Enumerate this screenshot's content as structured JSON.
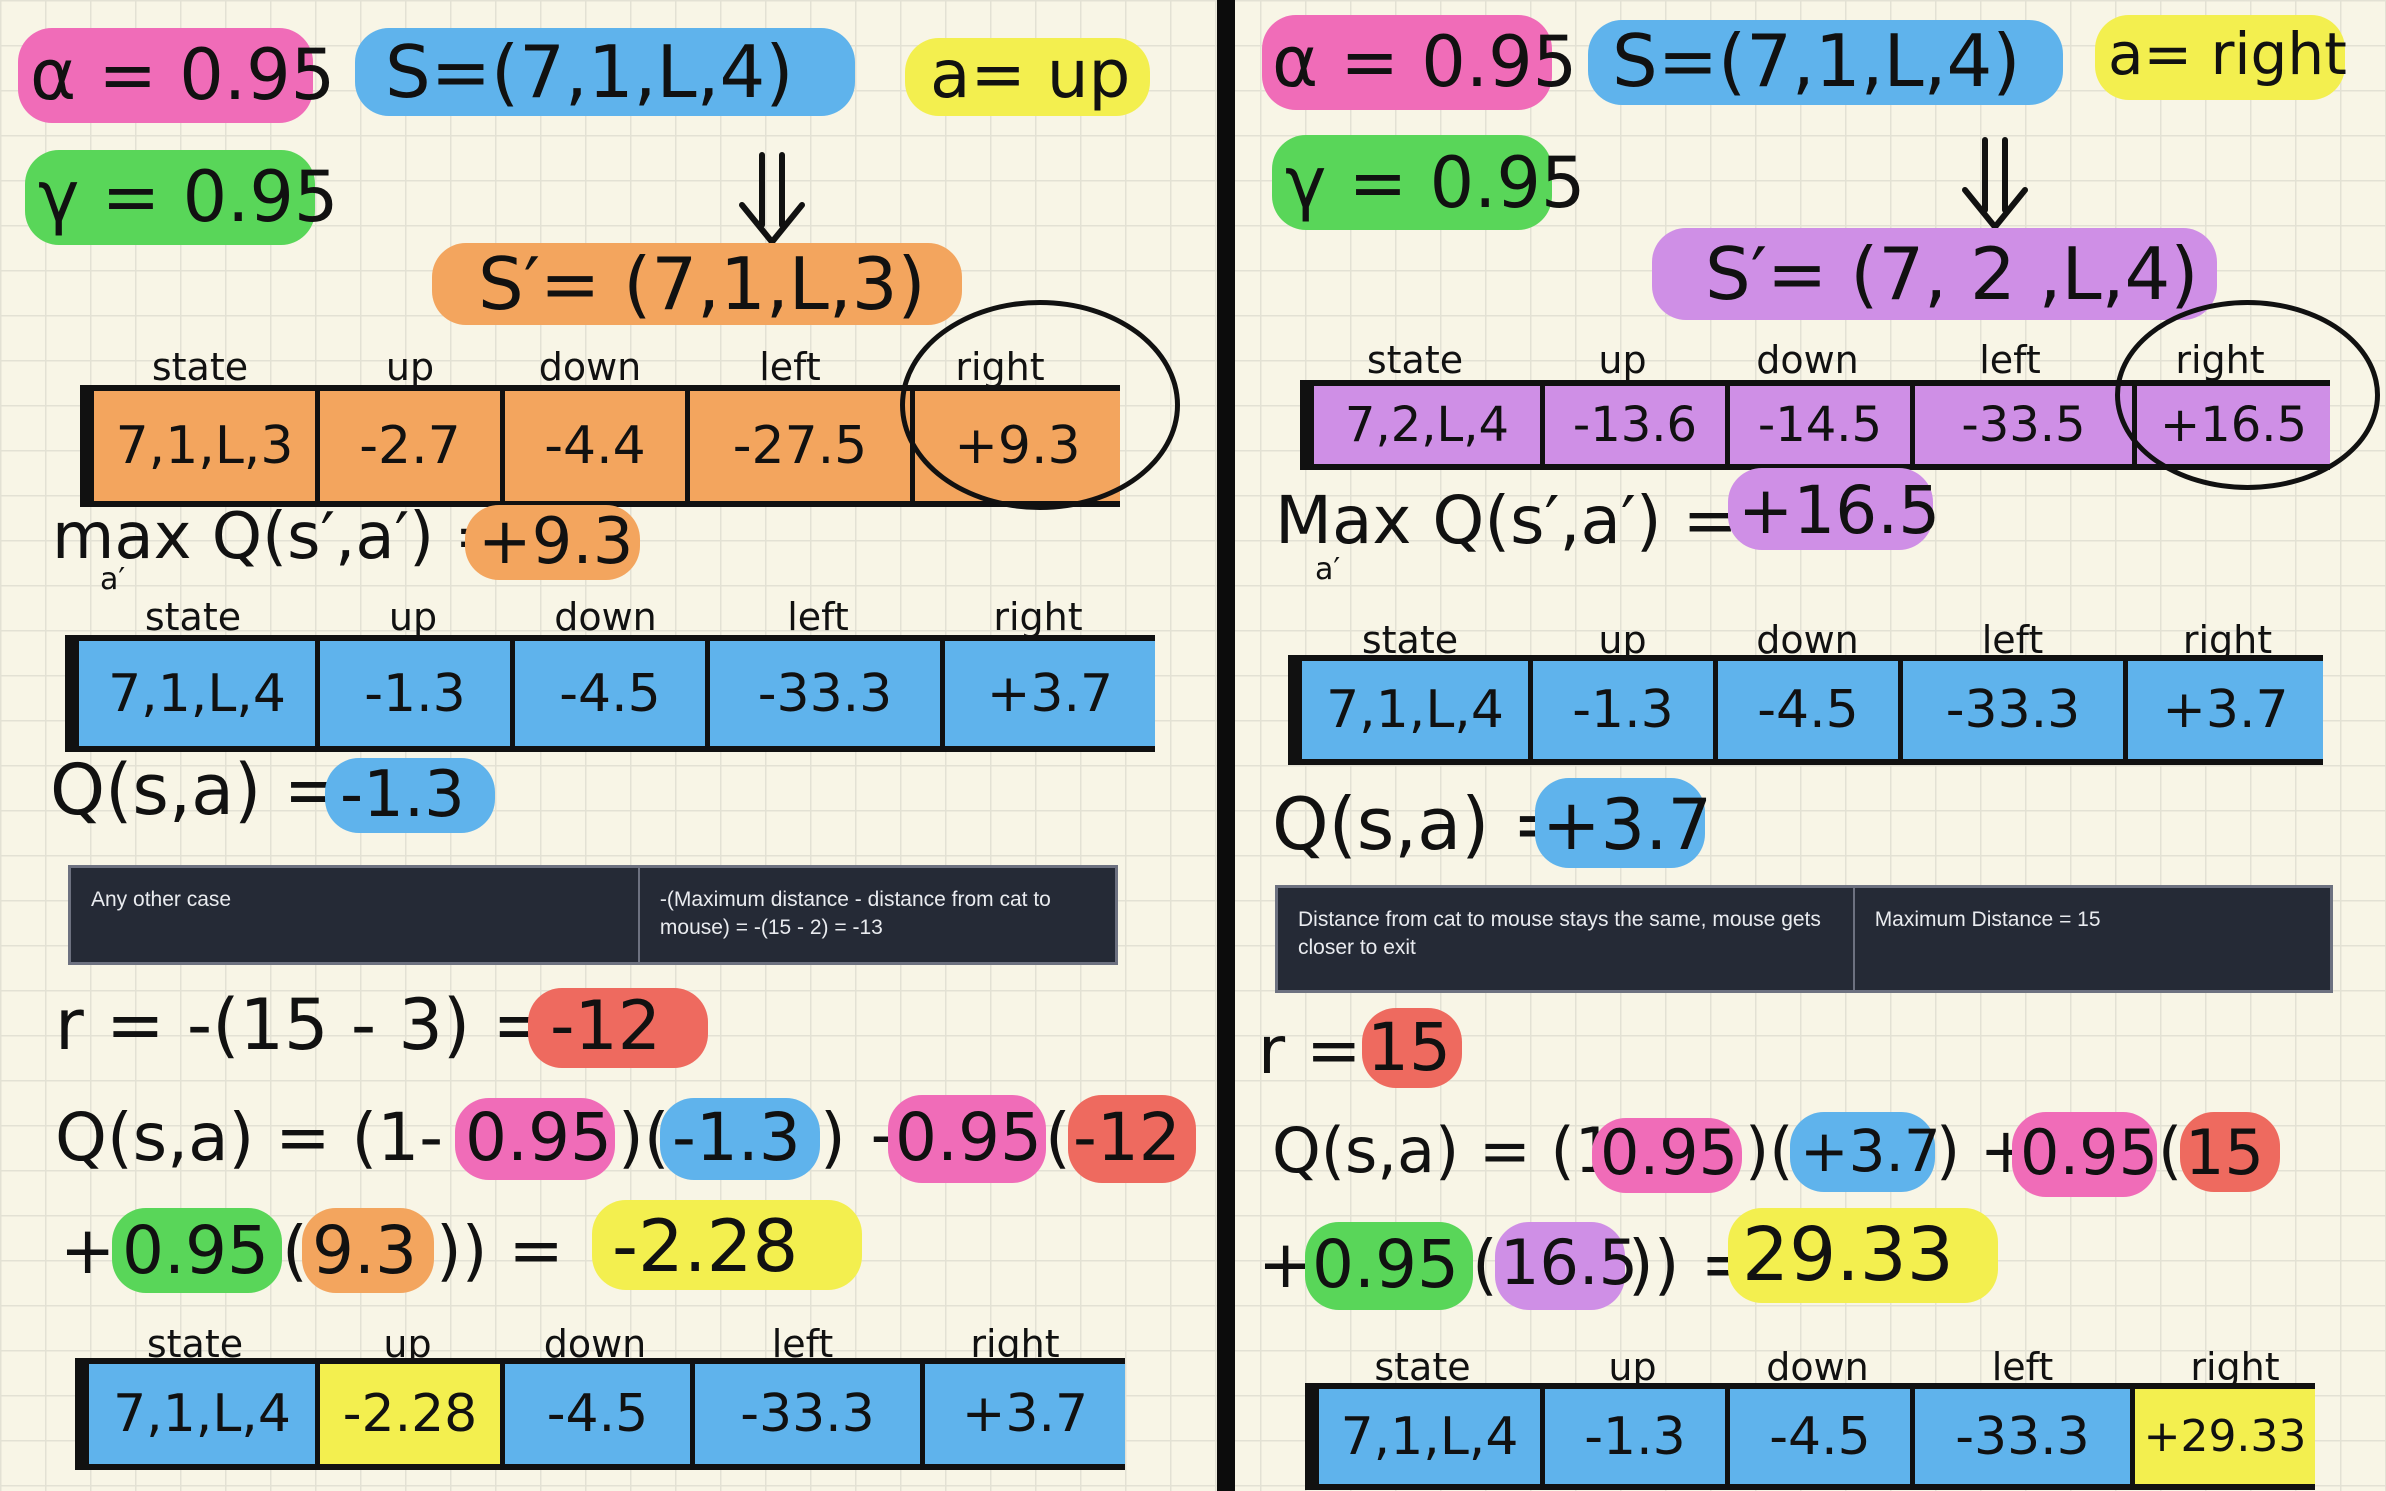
{
  "left": {
    "alpha": "α = 0.95",
    "gamma": "γ = 0.95",
    "state": "S=(7,1,L,4)",
    "action": "a= up",
    "next_state": "S′= (7,1,L,3)",
    "next_table": {
      "headers": [
        "state",
        "up",
        "down",
        "left",
        "right"
      ],
      "row": [
        "7,1,L,3",
        "-2.7",
        "-4.4",
        "-27.5",
        "+9.3"
      ]
    },
    "max_label": "max Q(s′,a′) =",
    "max_sub": "a′",
    "max_value": "+9.3",
    "cur_table": {
      "headers": [
        "state",
        "up",
        "down",
        "left",
        "right"
      ],
      "row": [
        "7,1,L,4",
        "-1.3",
        "-4.5",
        "-33.3",
        "+3.7"
      ]
    },
    "q_label": "Q(s,a) =",
    "q_value": "-1.3",
    "reward_table": {
      "case": "Any other case",
      "formula": "-(Maximum distance - distance from cat to mouse) = -(15 - 2) = -13"
    },
    "r_label": "r = -(15 - 3) =",
    "r_value": "-12",
    "update": {
      "line1_a": "Q(s,a) = (1-",
      "line1_alpha": "0.95",
      "line1_b": ")(",
      "line1_q": "-1.3",
      "line1_c": ") +",
      "line1_alpha2": "0.95",
      "line1_d": "(",
      "line1_r": "-12",
      "line2_a": "+",
      "line2_gamma": "0.95",
      "line2_b": "(",
      "line2_max": "9.3",
      "line2_c": "))  =",
      "line2_result": "-2.28"
    },
    "new_table": {
      "headers": [
        "state",
        "up",
        "down",
        "left",
        "right"
      ],
      "row": [
        "7,1,L,4",
        "-2.28",
        "-4.5",
        "-33.3",
        "+3.7"
      ]
    }
  },
  "right": {
    "alpha": "α = 0.95",
    "gamma": "γ = 0.95",
    "state": "S=(7,1,L,4)",
    "action": "a= right",
    "next_state": "S′= (7, 2 ,L,4)",
    "next_table": {
      "headers": [
        "state",
        "up",
        "down",
        "left",
        "right"
      ],
      "row": [
        "7,2,L,4",
        "-13.6",
        "-14.5",
        "-33.5",
        "+16.5"
      ]
    },
    "max_label": "Max Q(s′,a′) =",
    "max_sub": "a′",
    "max_value": "+16.5",
    "cur_table": {
      "headers": [
        "state",
        "up",
        "down",
        "left",
        "right"
      ],
      "row": [
        "7,1,L,4",
        "-1.3",
        "-4.5",
        "-33.3",
        "+3.7"
      ]
    },
    "q_label": "Q(s,a) =",
    "q_value": "+3.7",
    "reward_table": {
      "case": "Distance from cat to mouse stays the same, mouse gets closer to exit",
      "formula": "Maximum Distance = 15"
    },
    "r_label": "r =",
    "r_value": "15",
    "update": {
      "line1_a": "Q(s,a) = (1-",
      "line1_alpha": "0.95",
      "line1_b": ")(",
      "line1_q": "+3.7",
      "line1_c": ") +",
      "line1_alpha2": "0.95",
      "line1_d": "(",
      "line1_r": "15",
      "line2_a": "+",
      "line2_gamma": "0.95",
      "line2_b": "(",
      "line2_max": "16.5",
      "line2_c": ")) =",
      "line2_result": "29.33"
    },
    "new_table": {
      "headers": [
        "state",
        "up",
        "down",
        "left",
        "right"
      ],
      "row": [
        "7,1,L,4",
        "-1.3",
        "-4.5",
        "-33.3",
        "+29.33"
      ]
    }
  },
  "colors": {
    "pink": "#f06cb8",
    "blue": "#5fb3ec",
    "yellow": "#f3ef4f",
    "green": "#59d659",
    "orange": "#f3a55e",
    "purple": "#cf8fe6",
    "red": "#ee6a5f",
    "panel": "#252a36",
    "paper": "#f8f5e6"
  }
}
